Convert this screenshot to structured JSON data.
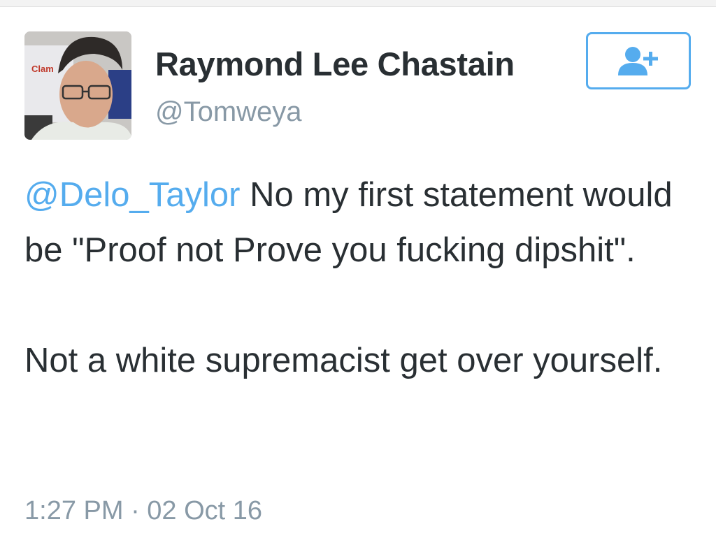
{
  "user": {
    "display_name": "Raymond Lee Chastain",
    "handle": "@Tomweya",
    "avatar_sign_text": "Clam"
  },
  "follow_button": {
    "icon": "follow-user-plus-icon"
  },
  "tweet": {
    "mention": "@Delo_Taylor",
    "line1_rest": " No my first statement would be \"Proof not Prove you fucking dipshit\".",
    "line2": "Not a white supremacist get over yourself.",
    "timestamp": "1:27 PM · 02 Oct 16"
  },
  "colors": {
    "accent": "#55acee",
    "text": "#292f33",
    "muted": "#8899a6"
  }
}
